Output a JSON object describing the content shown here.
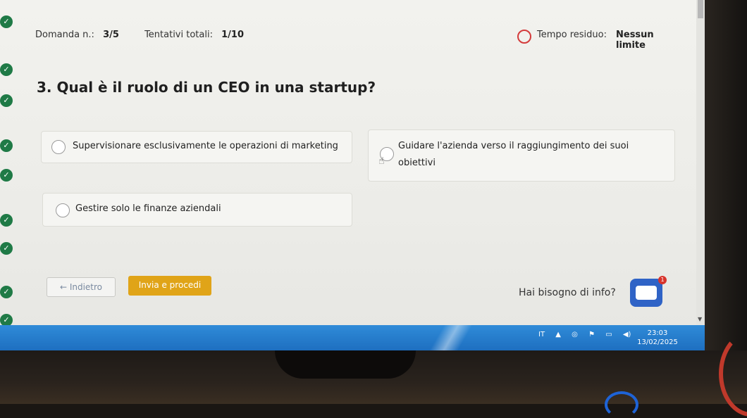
{
  "header": {
    "question_label": "Domanda n.:",
    "question_value": "3/5",
    "attempts_label": "Tentativi totali:",
    "attempts_value": "1/10",
    "time_label": "Tempo residuo:",
    "time_value": "Nessun limite"
  },
  "question": {
    "title": "3. Qual è il ruolo di un CEO in una startup?",
    "options": [
      {
        "label": "Supervisionare esclusivamente le operazioni di marketing"
      },
      {
        "label_line1": "Guidare l'azienda verso il raggiungimento dei suoi",
        "label_line2": "obiettivi"
      },
      {
        "label": "Gestire solo le finanze aziendali"
      }
    ]
  },
  "actions": {
    "back_label": "← Indietro",
    "submit_label": "Invia e procedi"
  },
  "help": {
    "text": "Hai bisogno di info?",
    "badge": "1"
  },
  "taskbar": {
    "language": "IT",
    "time": "23:03",
    "date": "13/02/2025"
  },
  "colors": {
    "submit_bg": "#e0a418",
    "timer_ring": "#d43b3b",
    "chat_button": "#2f63c6",
    "taskbar": "#1e6fc0",
    "check": "#1f7a46"
  },
  "icons": [
    "check-icon",
    "timer-icon",
    "radio-icon",
    "chat-icon",
    "cursor-icon",
    "speaker-icon",
    "flag-icon",
    "battery-icon",
    "up-arrow-icon"
  ]
}
